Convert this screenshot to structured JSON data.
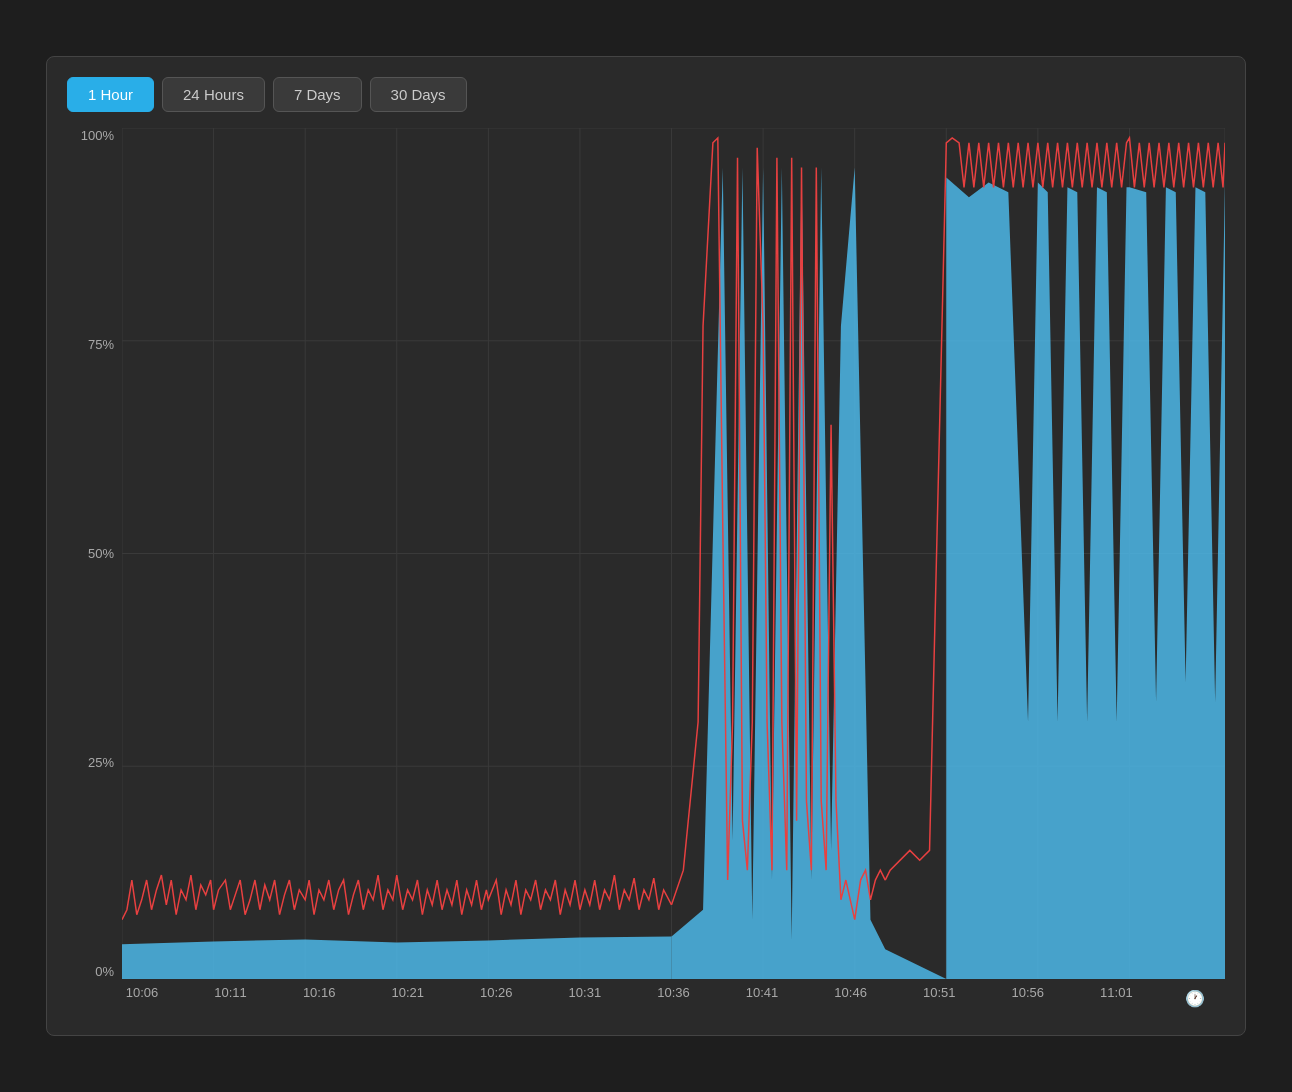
{
  "toolbar": {
    "buttons": [
      {
        "label": "1 Hour",
        "active": true
      },
      {
        "label": "24 Hours",
        "active": false
      },
      {
        "label": "7 Days",
        "active": false
      },
      {
        "label": "30 Days",
        "active": false
      }
    ]
  },
  "yAxis": {
    "labels": [
      "100%",
      "75%",
      "50%",
      "25%",
      "0%"
    ]
  },
  "xAxis": {
    "labels": [
      "10:06",
      "10:11",
      "10:16",
      "10:21",
      "10:26",
      "10:31",
      "10:36",
      "10:41",
      "10:46",
      "10:51",
      "10:56",
      "11:01"
    ]
  },
  "chart": {
    "colors": {
      "blue": "#4db8e8",
      "red": "#e84040",
      "grid": "#3a3a3a"
    }
  }
}
